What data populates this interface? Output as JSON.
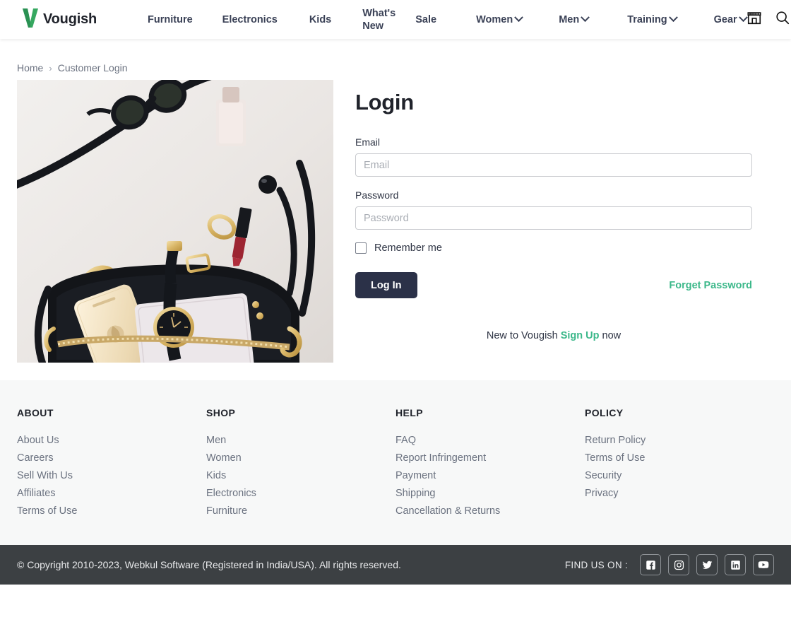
{
  "brand": {
    "name": "Vougish",
    "logo_icon": "v-logo-icon",
    "logo_color": "#36a860",
    "text_color": "#20232b"
  },
  "header": {
    "nav_items": [
      {
        "label": "Furniture",
        "has_dropdown": false,
        "wrap": false
      },
      {
        "label": "Electronics",
        "has_dropdown": false,
        "wrap": false
      },
      {
        "label": "Kids",
        "has_dropdown": false,
        "wrap": false
      },
      {
        "label": "What's New",
        "has_dropdown": false,
        "wrap": true
      },
      {
        "label": "Sale",
        "has_dropdown": false,
        "wrap": false
      },
      {
        "label": "Women",
        "has_dropdown": true,
        "wrap": false
      },
      {
        "label": "Men",
        "has_dropdown": true,
        "wrap": false
      },
      {
        "label": "Training",
        "has_dropdown": true,
        "wrap": false
      },
      {
        "label": "Gear",
        "has_dropdown": true,
        "wrap": false
      }
    ],
    "icons": [
      {
        "name": "store-icon"
      },
      {
        "name": "search-icon"
      },
      {
        "name": "user-account-icon"
      }
    ]
  },
  "breadcrumb": {
    "home": "Home",
    "separator": "›",
    "current": "Customer Login"
  },
  "hero": {
    "alt": "Fashion flat lay with sunglasses, gold rings, lipstick, gold phone, white wallet, black watch and black handbag"
  },
  "login": {
    "title": "Login",
    "email_label": "Email",
    "email_placeholder": "Email",
    "email_value": "",
    "password_label": "Password",
    "password_placeholder": "Password",
    "password_value": "",
    "remember_label": "Remember me",
    "remember_checked": false,
    "submit_label": "Log In",
    "forget_label": "Forget Password",
    "signup_prefix": "New to Vougish",
    "signup_link": "Sign Up",
    "signup_suffix": "now",
    "button_color": "#2b3148",
    "accent_color": "#3cb88a"
  },
  "footer": {
    "columns": [
      {
        "title": "ABOUT",
        "links": [
          "About Us",
          "Careers",
          "Sell With Us",
          "Affiliates",
          "Terms of Use"
        ]
      },
      {
        "title": "SHOP",
        "links": [
          "Men",
          "Women",
          "Kids",
          "Electronics",
          "Furniture"
        ]
      },
      {
        "title": "HELP",
        "links": [
          "FAQ",
          "Report Infringement",
          "Payment",
          "Shipping",
          "Cancellation & Returns"
        ]
      },
      {
        "title": "POLICY",
        "links": [
          "Return Policy",
          "Terms of Use",
          "Security",
          "Privacy"
        ]
      }
    ],
    "background": "#f7f8f8"
  },
  "copyright": {
    "text": "© Copyright 2010-2023, Webkul Software (Registered in India/USA). All rights reserved.",
    "find_us_label": "FIND US ON :",
    "socials": [
      {
        "name": "facebook-icon"
      },
      {
        "name": "instagram-icon"
      },
      {
        "name": "twitter-icon"
      },
      {
        "name": "linkedin-icon"
      },
      {
        "name": "youtube-icon"
      }
    ],
    "background": "#3c4043"
  }
}
